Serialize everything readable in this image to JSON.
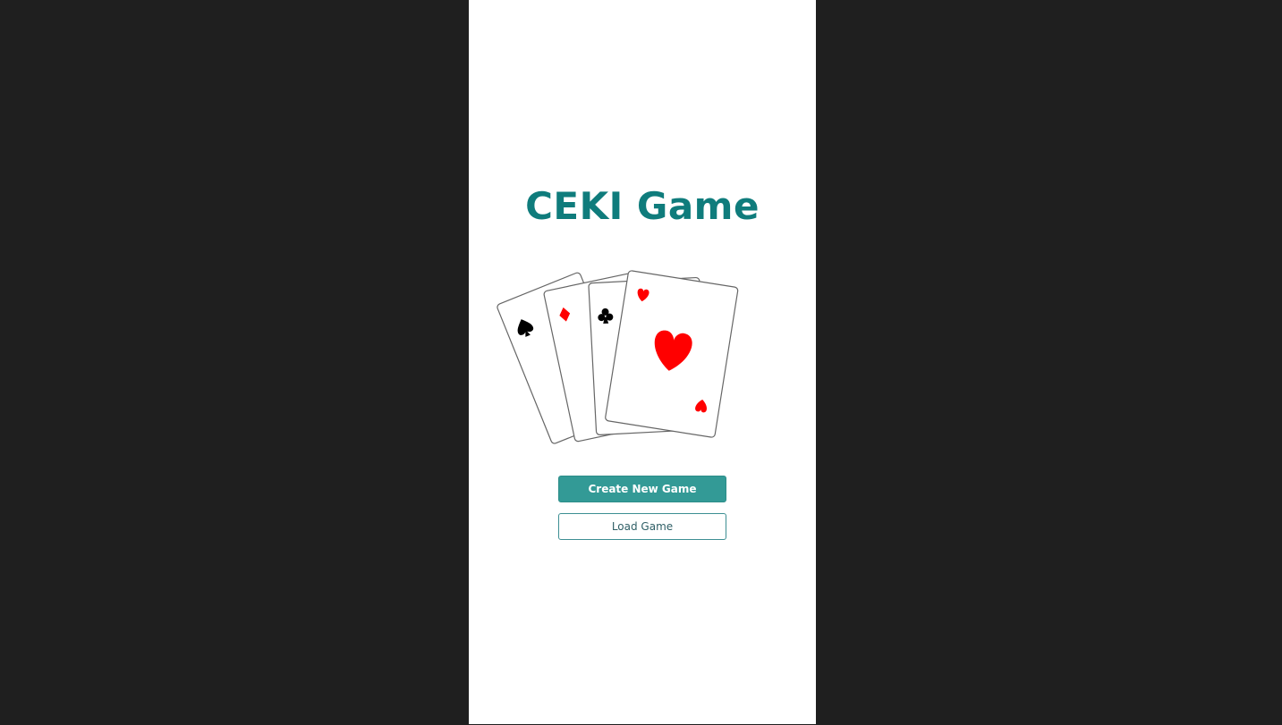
{
  "app": {
    "title": "CEKI Game"
  },
  "illustration": {
    "icon": "playing-cards-icon",
    "cards": [
      {
        "suit": "spade",
        "suit_color": "#000000"
      },
      {
        "suit": "diamond",
        "suit_color": "#ff0000"
      },
      {
        "suit": "club",
        "suit_color": "#000000"
      },
      {
        "suit": "heart",
        "suit_color": "#ff0000"
      }
    ]
  },
  "actions": {
    "create_label": "Create New Game",
    "load_label": "Load Game"
  },
  "colors": {
    "accent": "#0f7c7c",
    "button_primary": "#339a96",
    "background_outer": "#1f1f1f",
    "panel": "#ffffff"
  }
}
